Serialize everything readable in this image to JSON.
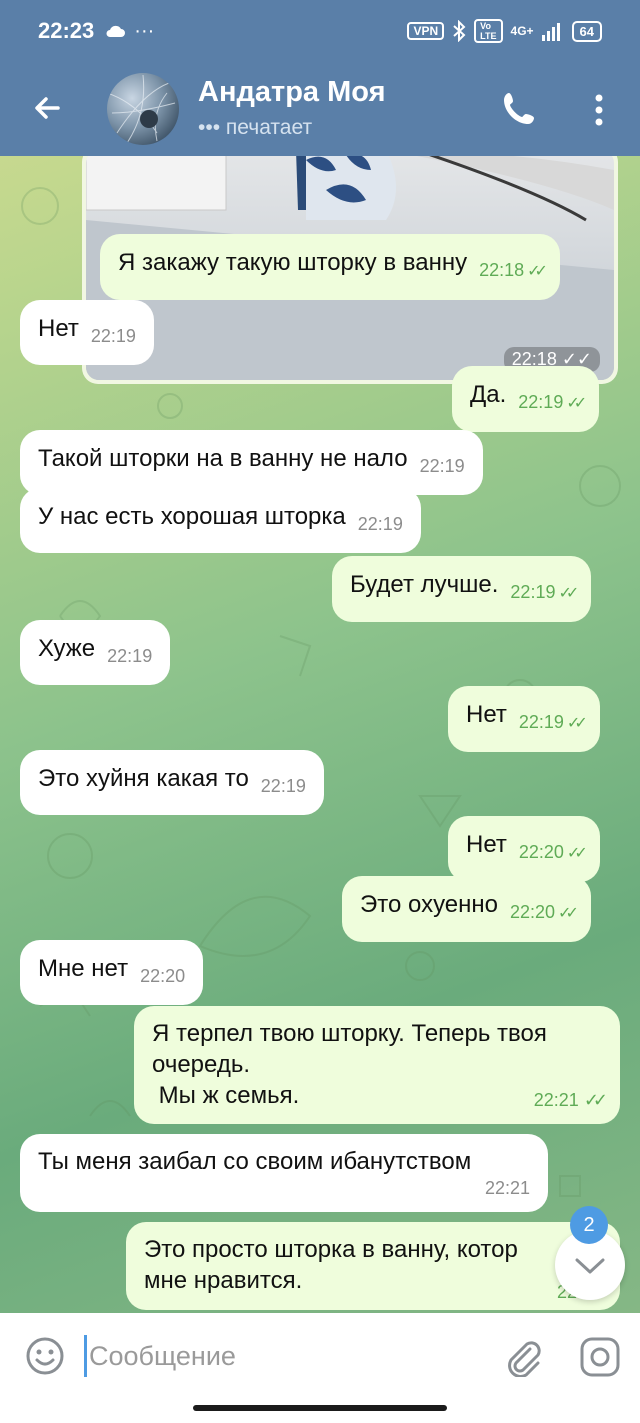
{
  "status_bar": {
    "time": "22:23",
    "vpn": "VPN",
    "network": "4G+",
    "battery": "64"
  },
  "header": {
    "contact_name": "Андатра Моя",
    "contact_status": "печатает",
    "typing_indicator": "•••"
  },
  "chat": {
    "photo_time": "22:18",
    "messages": [
      {
        "dir": "out",
        "text": "Я закажу такую шторку в ванну",
        "time": "22:18"
      },
      {
        "dir": "in",
        "text": "Нет",
        "time": "22:19"
      },
      {
        "dir": "out",
        "text": "Да.",
        "time": "22:19"
      },
      {
        "dir": "in",
        "text": "Такой шторки на в ванну не нало",
        "time": "22:19"
      },
      {
        "dir": "in",
        "text": "У нас есть хорошая шторка",
        "time": "22:19"
      },
      {
        "dir": "out",
        "text": "Будет лучше.",
        "time": "22:19"
      },
      {
        "dir": "in",
        "text": "Хуже",
        "time": "22:19"
      },
      {
        "dir": "out",
        "text": "Нет",
        "time": "22:19"
      },
      {
        "dir": "in",
        "text": "Это хуйня какая то",
        "time": "22:19"
      },
      {
        "dir": "out",
        "text": "Нет",
        "time": "22:20"
      },
      {
        "dir": "out",
        "text": "Это охуенно",
        "time": "22:20"
      },
      {
        "dir": "in",
        "text": "Мне нет",
        "time": "22:20"
      },
      {
        "dir": "out",
        "text_lines": [
          "Я терпел твою шторку. Теперь твоя",
          "очередь.",
          " Мы ж семья."
        ],
        "time": "22:21"
      },
      {
        "dir": "in",
        "text": "Ты меня заибал со своим ибанутством",
        "time": "22:21"
      },
      {
        "dir": "out",
        "text_lines": [
          "Это просто шторка в ванну, котор",
          "мне нравится."
        ],
        "time": "22:22"
      }
    ],
    "unread_count": "2"
  },
  "input": {
    "placeholder": "Сообщение"
  },
  "colors": {
    "header_bg": "#5a7fa8",
    "outgoing_bubble": "#effddc",
    "incoming_bubble": "#ffffff",
    "tick_color": "#5fab56",
    "badge_color": "#4e9be3"
  }
}
